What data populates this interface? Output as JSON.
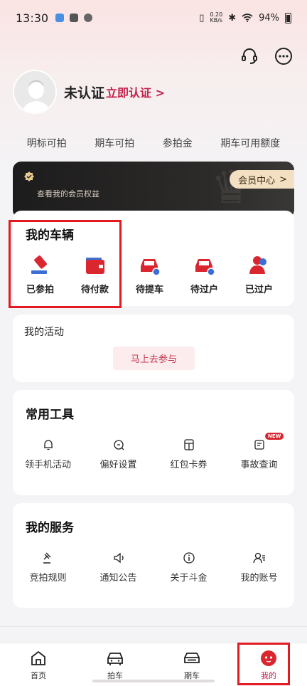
{
  "status_bar": {
    "time": "13:30",
    "net_speed_value": "0.20",
    "net_speed_unit": "KB/s",
    "battery": "94%"
  },
  "header": {
    "support_icon": "headset-icon",
    "more_icon": "more-dots-icon"
  },
  "profile": {
    "username": "未认证",
    "verify_link": "立即认证 >"
  },
  "stats": [
    "明标可拍",
    "期车可拍",
    "参拍金",
    "期车可用额度"
  ],
  "member": {
    "benefits_text": "查看我的会员权益",
    "center_button": "会员中心",
    "center_arrow": ">"
  },
  "my_vehicles": {
    "title": "我的车辆",
    "items": [
      {
        "label": "已参拍",
        "icon": "auction-hammer-icon"
      },
      {
        "label": "待付款",
        "icon": "wallet-icon"
      },
      {
        "label": "待提车",
        "icon": "car-pickup-icon"
      },
      {
        "label": "待过户",
        "icon": "car-transfer-icon"
      },
      {
        "label": "已过户",
        "icon": "users-transferred-icon"
      }
    ]
  },
  "my_activity": {
    "title": "我的活动",
    "join_button": "马上去参与"
  },
  "common_tools": {
    "title": "常用工具",
    "items": [
      {
        "label": "领手机活动",
        "icon": "bell-icon"
      },
      {
        "label": "偏好设置",
        "icon": "preference-icon"
      },
      {
        "label": "红包卡券",
        "icon": "coupon-icon"
      },
      {
        "label": "事故查询",
        "icon": "accident-query-icon",
        "badge": "NEW"
      }
    ]
  },
  "my_services": {
    "title": "我的服务",
    "items": [
      {
        "label": "竞拍规则",
        "icon": "gavel-icon"
      },
      {
        "label": "通知公告",
        "icon": "speaker-icon"
      },
      {
        "label": "关于斗金",
        "icon": "info-icon"
      },
      {
        "label": "我的账号",
        "icon": "account-icon"
      }
    ]
  },
  "tabbar": [
    {
      "label": "首页",
      "icon": "home-icon"
    },
    {
      "label": "拍车",
      "icon": "car-front-icon"
    },
    {
      "label": "期车",
      "icon": "car-side-icon"
    },
    {
      "label": "我的",
      "icon": "mine-icon",
      "active": true
    }
  ],
  "colors": {
    "accent": "#c4204a",
    "highlight_box": "#e21b23",
    "member_gold": "#f3dfc2"
  }
}
